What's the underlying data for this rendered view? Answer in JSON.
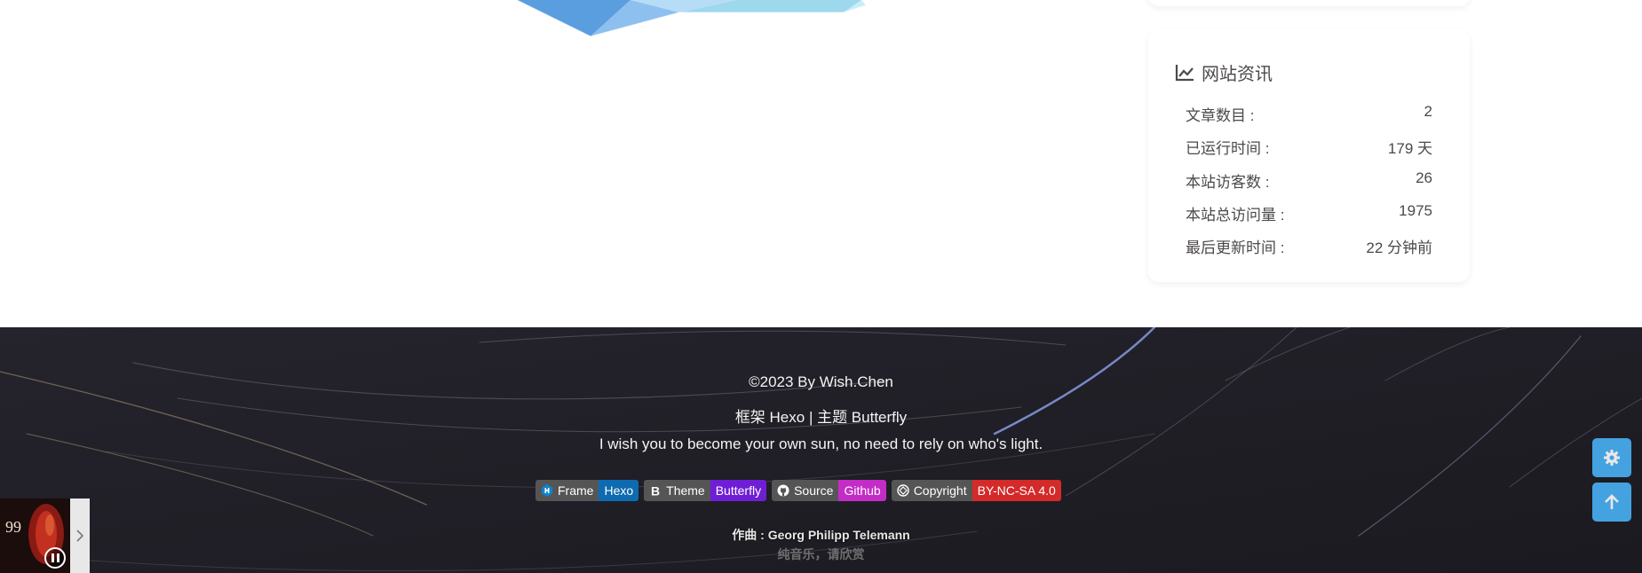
{
  "site_info": {
    "title": "网站资讯",
    "title_icon": "line-chart-icon",
    "rows": [
      {
        "label": "文章数目 :",
        "value": "2"
      },
      {
        "label": "已运行时间 :",
        "value": "179 天"
      },
      {
        "label": "本站访客数 :",
        "value": "26"
      },
      {
        "label": "本站总访问量 :",
        "value": "1975"
      },
      {
        "label": "最后更新时间 :",
        "value": "22 分钟前"
      }
    ]
  },
  "footer": {
    "copyright": "©2023 By Wish.Chen",
    "framework_line": "框架 Hexo | 主题 Butterfly",
    "motto": "I wish you to become your own sun, no need to rely on who's light.",
    "badges": [
      {
        "icon": "hexo-icon",
        "label": "Frame",
        "value": "Hexo",
        "color": "#0e6bb0"
      },
      {
        "icon": "bold-b-icon",
        "label": "Theme",
        "value": "Butterfly",
        "color": "#6f1ed6"
      },
      {
        "icon": "github-icon",
        "label": "Source",
        "value": "Github",
        "color": "#c42cc7"
      },
      {
        "icon": "copyright-icon",
        "label": "Copyright",
        "value": "BY-NC-SA 4.0",
        "color": "#d42a2a"
      }
    ]
  },
  "player": {
    "composer_line": "作曲 : Georg Philipp Telemann",
    "sub_line": "纯音乐，请欣赏",
    "cover_text": "99"
  },
  "side_buttons": {
    "settings_icon": "gear-icon",
    "top_icon": "arrow-up-icon",
    "accent": "#49b1f5"
  }
}
